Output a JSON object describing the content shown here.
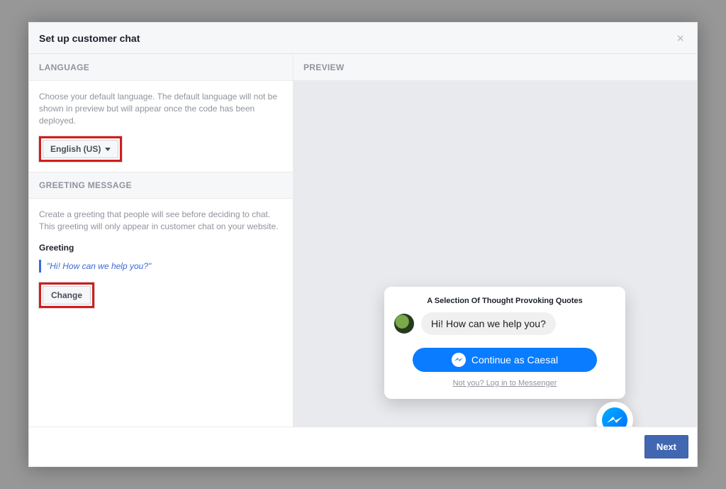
{
  "header": {
    "title": "Set up customer chat"
  },
  "sections": {
    "language_heading": "LANGUAGE",
    "preview_heading": "PREVIEW",
    "greeting_heading": "GREETING MESSAGE"
  },
  "language": {
    "description": "Choose your default language. The default language will not be shown in preview but will appear once the code has been deployed.",
    "selected": "English (US)"
  },
  "greeting": {
    "description": "Create a greeting that people will see before deciding to chat. This greeting will only appear in customer chat on your website.",
    "label": "Greeting",
    "quote": "\"Hi! How can we help you?\"",
    "change_label": "Change"
  },
  "preview": {
    "card_title": "A Selection Of Thought Provoking Quotes",
    "greeting_bubble": "Hi! How can we help you?",
    "cta": "Continue as Caesal",
    "alt_link": "Not you? Log in to Messenger"
  },
  "footer": {
    "next": "Next"
  }
}
